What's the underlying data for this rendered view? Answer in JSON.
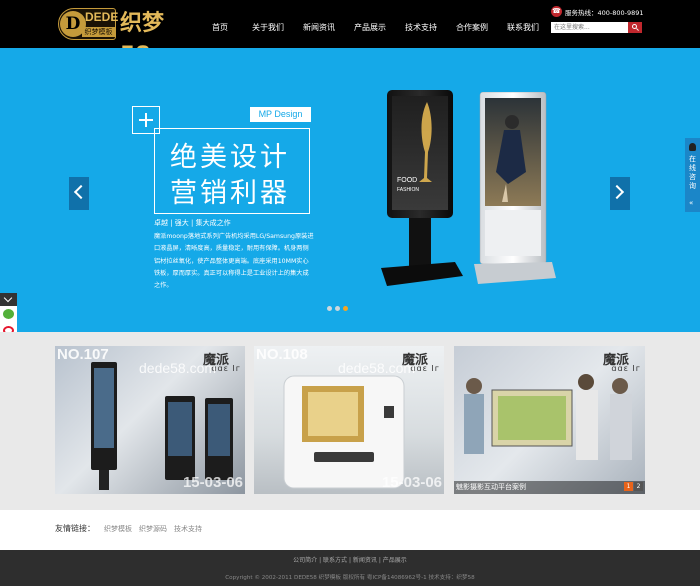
{
  "header": {
    "logo_badge_text": "DEDE",
    "logo_badge_sub": "织梦模板",
    "logo_brand": "织梦58",
    "nav": [
      "首页",
      "关于我们",
      "新闻资讯",
      "产品展示",
      "技术支持",
      "合作案例",
      "联系我们"
    ],
    "hotline": "服务热线：400-800-9891",
    "search_placeholder": "在这里搜索..."
  },
  "banner": {
    "tag": "MP Design",
    "title_line1": "绝美设计",
    "title_line2": "营销利器",
    "slogan": "卓越 | 强大 | 集大成之作",
    "description": "魔派moonp落地式系列广告机均采用LG/Samsung原装进口液晶屏，清晰度高，质量稳定，耐用有保障。机身两侧铝材拉丝氧化，使产品整体更高端。底座采用10MM实心铁板，厚而厚实。真正可以称得上是工业设计上的集大成之作。",
    "poster_text1": "FOOD",
    "poster_text2": "FASHION",
    "slides_count": 3,
    "active_slide": 3
  },
  "float_tab": {
    "label": "在线咨询",
    "collapse": "«"
  },
  "cases": [
    {
      "no": "NO.107",
      "brand": "魔派",
      "brand_en": "ɑɑɛ Ιг",
      "watermark": "dede58.com",
      "date": "15-03-06"
    },
    {
      "no": "NO.108",
      "brand": "魔派",
      "brand_en": "ɑɑɛ Ιг",
      "watermark": "dede58.com",
      "date": "15-03-06"
    },
    {
      "no": "",
      "brand": "魔派",
      "brand_en": "ɑɑɛ Ιг",
      "watermark": "",
      "date": "",
      "caption": "魅影摄影互动平台案例",
      "pages": [
        "1",
        "2"
      ]
    }
  ],
  "links": {
    "label": "友情链接：",
    "items": [
      "织梦模板",
      "织梦源码",
      "技术支持"
    ]
  },
  "footer": {
    "nav": [
      "公司简介",
      "联系方式",
      "新闻资讯",
      "产品展示"
    ],
    "copyright": "Copyright © 2002-2011 DEDE58 织梦模板 版权所有 粤ICP备14086962号-1    技术支持：织梦58"
  },
  "colors": {
    "banner_bg": "#15a9e8",
    "header_bg": "#000000",
    "accent_red": "#c0272d",
    "gold": "#c59b3b",
    "footer_bg": "#2e2e2e"
  }
}
